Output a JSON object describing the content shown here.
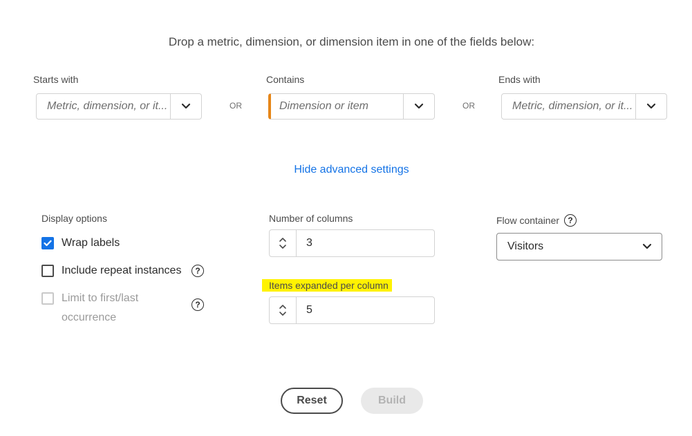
{
  "instruction": "Drop a metric, dimension, or dimension item in one of the fields below:",
  "fields": {
    "starts_with": {
      "label": "Starts with",
      "placeholder": "Metric, dimension, or it..."
    },
    "contains": {
      "label": "Contains",
      "placeholder": "Dimension or item"
    },
    "ends_with": {
      "label": "Ends with",
      "placeholder": "Metric, dimension, or it..."
    },
    "or_label": "OR"
  },
  "advanced_link": "Hide advanced settings",
  "display_options": {
    "title": "Display options",
    "wrap_labels": {
      "label": "Wrap labels",
      "checked": true
    },
    "include_repeat": {
      "label": "Include repeat instances",
      "checked": false
    },
    "limit_first_last": {
      "label_line1": "Limit to first/last",
      "label_line2": "occurrence",
      "checked": false,
      "disabled": true
    }
  },
  "columns": {
    "label": "Number of columns",
    "value": "3"
  },
  "items_expanded": {
    "label": "Items expanded per column",
    "value": "5"
  },
  "flow_container": {
    "label": "Flow container",
    "value": "Visitors"
  },
  "buttons": {
    "reset": "Reset",
    "build": "Build"
  },
  "colors": {
    "accent": "#1473e6",
    "active_field": "#e68619",
    "highlight": "#fff200"
  }
}
